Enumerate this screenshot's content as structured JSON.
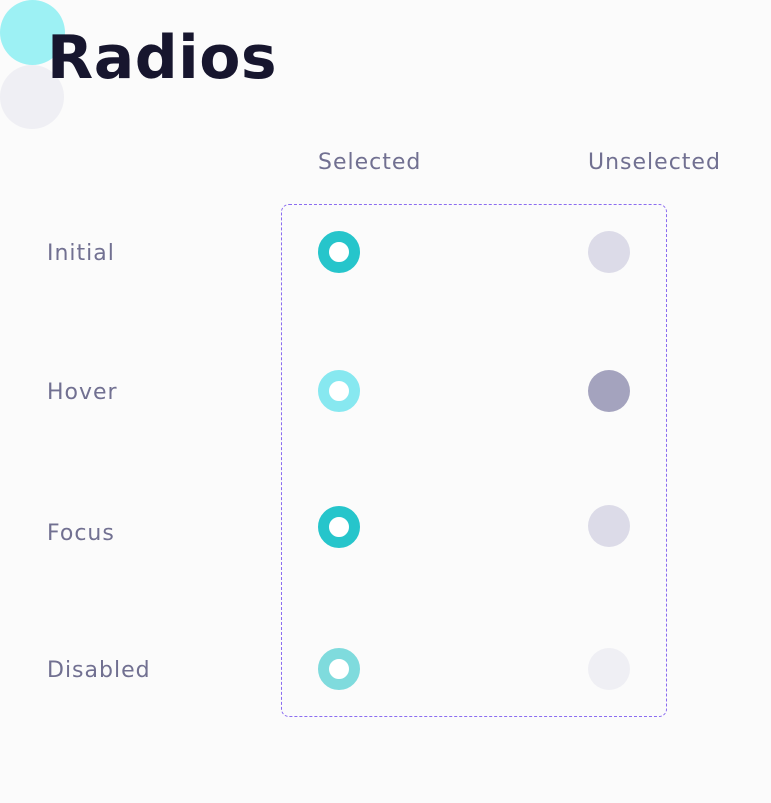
{
  "title": "Radios",
  "columns": {
    "selected": "Selected",
    "unselected": "Unselected"
  },
  "rows": {
    "initial": "Initial",
    "hover": "Hover",
    "focus": "Focus",
    "disabled": "Disabled"
  },
  "colors": {
    "selected_initial": "#26c5cb",
    "selected_hover": "#87e8f0",
    "selected_focus_ring": "#9df1f4",
    "selected_disabled": "#7fdbdd",
    "unselected_initial": "#dcdbe8",
    "unselected_hover": "#a4a3be",
    "unselected_focus_ring": "#efeff4",
    "unselected_disabled": "#efeff4",
    "group_border": "#8b6cf0",
    "title": "#17162e",
    "label": "#717091"
  }
}
